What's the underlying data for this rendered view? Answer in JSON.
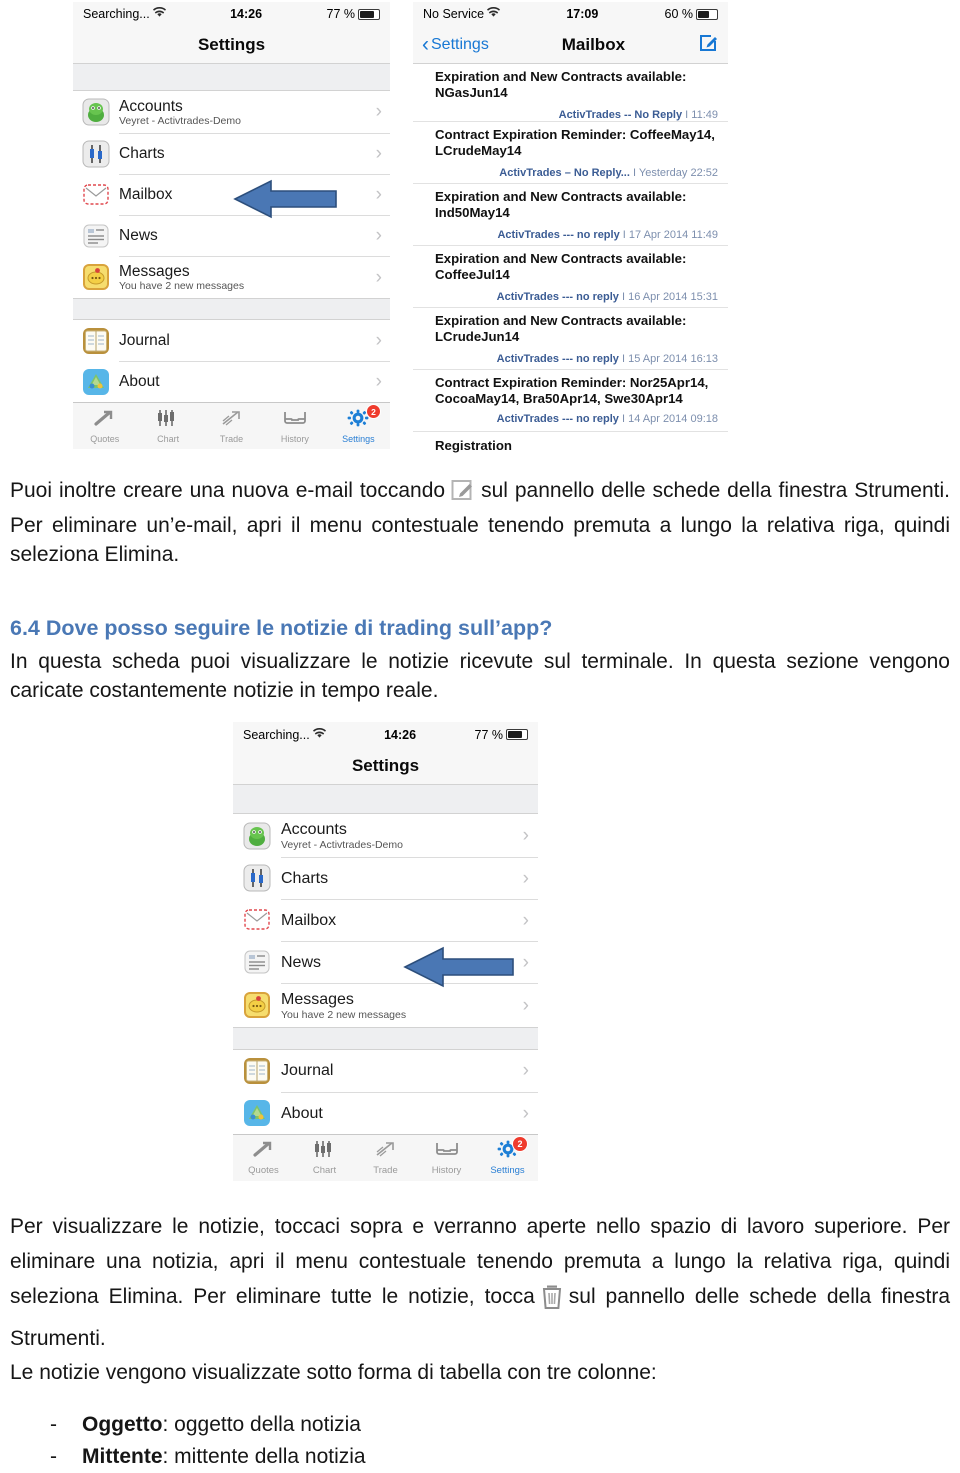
{
  "document": {
    "paragraph1_pre": "Puoi inoltre creare una nuova e-mail toccando",
    "paragraph1_post": "sul pannello delle schede della finestra Strumenti. Per eliminare un’e-mail, apri il menu contestuale tenendo premuta a lungo la relativa riga, quindi seleziona Elimina.",
    "heading": "6.4 Dove posso seguire le notizie di trading sull’app?",
    "paragraph2": "In questa scheda puoi visualizzare le notizie ricevute sul terminale. In questa sezione vengono caricate costantemente notizie in tempo reale.",
    "paragraph3_pre": "Per visualizzare le notizie, toccaci sopra e verranno aperte nello spazio di lavoro superiore. Per eliminare una notizia, apri il menu contestuale tenendo premuta a lungo la relativa riga, quindi seleziona Elimina. Per eliminare tutte le notizie, tocca",
    "paragraph3_post": "sul pannello delle schede della finestra Strumenti.",
    "paragraph4": "Le notizie vengono visualizzate sotto forma di tabella con tre colonne:",
    "bullets": [
      {
        "dash": "-",
        "term": "Oggetto",
        "desc": ": oggetto della notizia"
      },
      {
        "dash": "-",
        "term": "Mittente",
        "desc": ": mittente della notizia"
      }
    ],
    "inline_icons": {
      "compose": "compose-mail-icon",
      "trash": "trash-bin-icon"
    },
    "colors": {
      "heading": "#4a78b5",
      "arrow": "#4a77b4",
      "link_blue": "#1878d4",
      "badge_red": "#ef3b2d"
    }
  },
  "screenshot_settings_top": {
    "status": {
      "carrier": "Searching...",
      "wifi": "wifi-icon",
      "time": "14:26",
      "battery_pct": "77 %"
    },
    "nav": {
      "title": "Settings"
    },
    "rows": [
      {
        "icon": "accounts-icon",
        "title": "Accounts",
        "sub": "Veyret - Activtrades-Demo",
        "chevron": "›"
      },
      {
        "icon": "charts-icon",
        "title": "Charts",
        "sub": "",
        "chevron": "›"
      },
      {
        "icon": "mailbox-icon",
        "title": "Mailbox",
        "sub": "",
        "chevron": "›"
      },
      {
        "icon": "news-icon",
        "title": "News",
        "sub": "",
        "chevron": "›"
      },
      {
        "icon": "messages-icon",
        "title": "Messages",
        "sub": "You have 2 new messages",
        "chevron": "›"
      }
    ],
    "rows2": [
      {
        "icon": "journal-icon",
        "title": "Journal",
        "sub": "",
        "chevron": "›"
      },
      {
        "icon": "about-icon",
        "title": "About",
        "sub": "",
        "chevron": "›"
      }
    ],
    "tabs": [
      {
        "label": "Quotes",
        "icon": "quotes-icon",
        "active": false,
        "badge": ""
      },
      {
        "label": "Chart",
        "icon": "chart-icon",
        "active": false,
        "badge": ""
      },
      {
        "label": "Trade",
        "icon": "trade-icon",
        "active": false,
        "badge": ""
      },
      {
        "label": "History",
        "icon": "history-icon",
        "active": false,
        "badge": ""
      },
      {
        "label": "Settings",
        "icon": "settings-gear-icon",
        "active": true,
        "badge": "2"
      }
    ],
    "annotation": {
      "type": "arrow-left",
      "points_to": "Mailbox"
    }
  },
  "screenshot_mailbox": {
    "status": {
      "carrier": "No Service",
      "wifi": "wifi-icon",
      "time": "17:09",
      "battery_pct": "60 %"
    },
    "nav": {
      "back": "Settings",
      "title": "Mailbox",
      "right_icon": "compose-mail-icon"
    },
    "messages": [
      {
        "subject": "Expiration and New Contracts available: NGasJun14",
        "sender": "ActivTrades  --  No Reply",
        "time": "I 11:49"
      },
      {
        "subject": "Contract Expiration Reminder: CoffeeMay14, LCrudeMay14",
        "sender": "ActivTrades  –  No Reply...",
        "time": "I Yesterday 22:52"
      },
      {
        "subject": "Expiration and New Contracts available: Ind50May14",
        "sender": "ActivTrades  ---  no reply",
        "time": "I 17 Apr 2014 11:49"
      },
      {
        "subject": "Expiration and New Contracts available: CoffeeJul14",
        "sender": "ActivTrades  ---  no reply",
        "time": "I 16 Apr 2014 15:31"
      },
      {
        "subject": "Expiration and New Contracts available: LCrudeJun14",
        "sender": "ActivTrades  ---  no reply",
        "time": "I 15 Apr 2014 16:13"
      },
      {
        "subject": "Contract Expiration Reminder: Nor25Apr14, CocoaMay14, Bra50Apr14, Swe30Apr14",
        "sender": "ActivTrades  ---  no reply",
        "time": "I 14 Apr 2014 09:18"
      },
      {
        "subject": "Registration",
        "sender": "",
        "time": ""
      }
    ]
  },
  "screenshot_settings_news": {
    "status": {
      "carrier": "Searching...",
      "wifi": "wifi-icon",
      "time": "14:26",
      "battery_pct": "77 %"
    },
    "nav": {
      "title": "Settings"
    },
    "rows": [
      {
        "icon": "accounts-icon",
        "title": "Accounts",
        "sub": "Veyret - Activtrades-Demo",
        "chevron": "›"
      },
      {
        "icon": "charts-icon",
        "title": "Charts",
        "sub": "",
        "chevron": "›"
      },
      {
        "icon": "mailbox-icon",
        "title": "Mailbox",
        "sub": "",
        "chevron": "›"
      },
      {
        "icon": "news-icon",
        "title": "News",
        "sub": "",
        "chevron": "›"
      },
      {
        "icon": "messages-icon",
        "title": "Messages",
        "sub": "You have 2 new messages",
        "chevron": "›"
      }
    ],
    "rows2": [
      {
        "icon": "journal-icon",
        "title": "Journal",
        "sub": "",
        "chevron": "›"
      },
      {
        "icon": "about-icon",
        "title": "About",
        "sub": "",
        "chevron": "›"
      }
    ],
    "tabs": [
      {
        "label": "Quotes",
        "icon": "quotes-icon",
        "active": false,
        "badge": ""
      },
      {
        "label": "Chart",
        "icon": "chart-icon",
        "active": false,
        "badge": ""
      },
      {
        "label": "Trade",
        "icon": "trade-icon",
        "active": false,
        "badge": ""
      },
      {
        "label": "History",
        "icon": "history-icon",
        "active": false,
        "badge": ""
      },
      {
        "label": "Settings",
        "icon": "settings-gear-icon",
        "active": true,
        "badge": "2"
      }
    ],
    "annotation": {
      "type": "arrow-left",
      "points_to": "News"
    }
  }
}
